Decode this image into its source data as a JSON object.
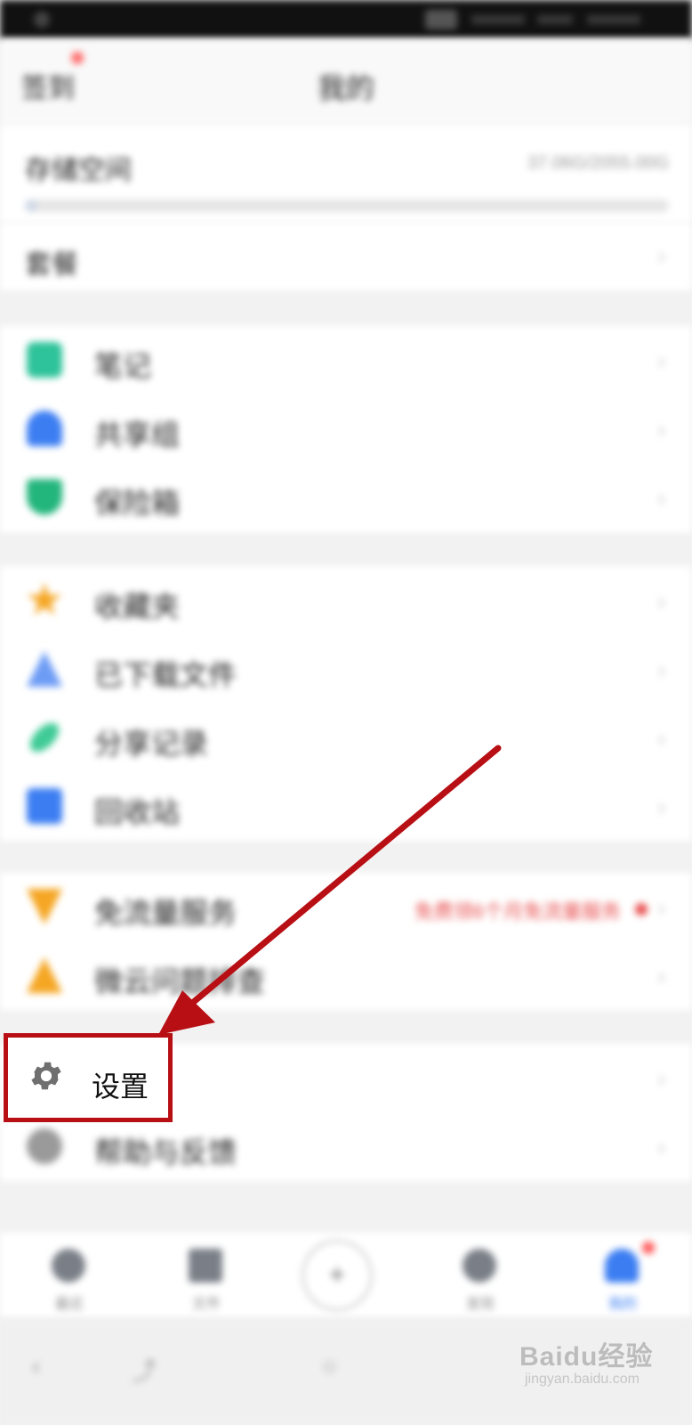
{
  "header": {
    "sign_in": "签到",
    "title": "我的"
  },
  "storage": {
    "label": "存储空间",
    "value": "37.06G/2055.00G",
    "used_fraction": 0.02
  },
  "vip": {
    "label": "套餐"
  },
  "group1": [
    {
      "label": "笔记",
      "icon": "note-icon"
    },
    {
      "label": "共享组",
      "icon": "group-icon"
    },
    {
      "label": "保险箱",
      "icon": "safe-icon"
    }
  ],
  "group2": [
    {
      "label": "收藏夹",
      "icon": "star-icon"
    },
    {
      "label": "已下载文件",
      "icon": "download-icon"
    },
    {
      "label": "分享记录",
      "icon": "link-icon"
    },
    {
      "label": "回收站",
      "icon": "trash-icon"
    }
  ],
  "group3": [
    {
      "label": "免流量服务",
      "icon": "gift-icon",
      "extra": "免费领6个月免流量服务"
    },
    {
      "label": "微云问题排查",
      "icon": "warning-icon"
    }
  ],
  "group4": [
    {
      "label": "设置",
      "icon": "gear-icon"
    },
    {
      "label": "帮助与反馈",
      "icon": "help-icon"
    }
  ],
  "tabs": [
    {
      "label": "最近",
      "icon": "clock-icon"
    },
    {
      "label": "文件",
      "icon": "folder-icon"
    },
    {
      "label": "",
      "icon": "plus-icon"
    },
    {
      "label": "发现",
      "icon": "discover-icon"
    },
    {
      "label": "我的",
      "icon": "person-icon"
    }
  ],
  "watermark": {
    "brand": "Baidu经验",
    "url": "jingyan.baidu.com"
  },
  "colors": {
    "highlight": "#b80f14",
    "accent": "#3c7ef2",
    "alert": "#e94f4f"
  }
}
